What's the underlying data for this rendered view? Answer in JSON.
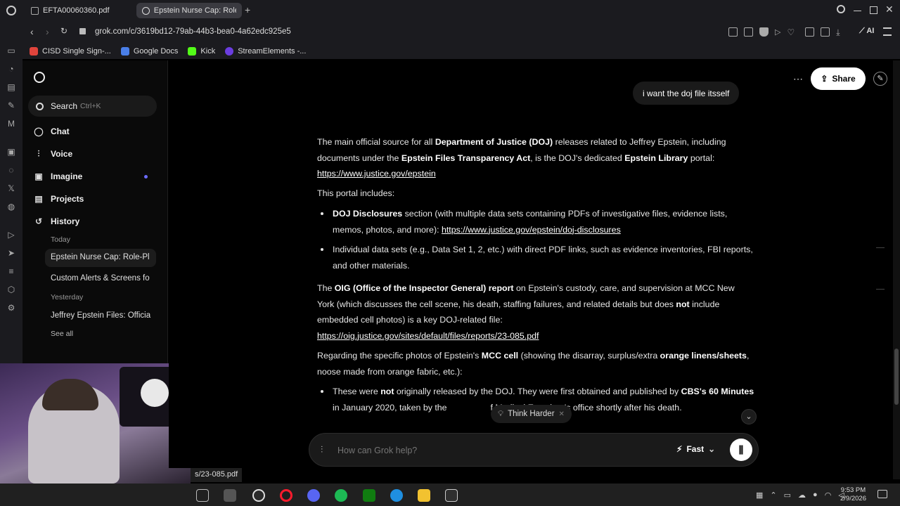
{
  "browser": {
    "tabs": [
      {
        "label": "EFTA00060360.pdf",
        "active": false
      },
      {
        "label": "Epstein Nurse Cap: Role-P",
        "active": true
      }
    ],
    "address": "grok.com/c/3619bd12-79ab-44b3-bea0-4a62edc925e5",
    "bookmarks": [
      {
        "label": "CISD Single Sign-...",
        "color": "#e0443c"
      },
      {
        "label": "Google Docs",
        "color": "#4a7fe8"
      },
      {
        "label": "Kick",
        "color": "#53fc18"
      },
      {
        "label": "StreamElements -...",
        "color": "#6b3de0"
      }
    ],
    "ai_label": "AI"
  },
  "sidebar": {
    "search_label": "Search",
    "search_shortcut": "Ctrl+K",
    "nav": [
      {
        "label": "Chat",
        "icon": "chat-icon"
      },
      {
        "label": "Voice",
        "icon": "voice-icon"
      },
      {
        "label": "Imagine",
        "icon": "imagine-icon"
      },
      {
        "label": "Projects",
        "icon": "projects-icon"
      },
      {
        "label": "History",
        "icon": "history-icon"
      }
    ],
    "history_today_label": "Today",
    "history_yesterday_label": "Yesterday",
    "history_items": [
      "Epstein Nurse Cap: Role-Pl",
      "Custom Alerts & Screens fo",
      "Jeffrey Epstein Files: Officia"
    ],
    "see_all": "See all"
  },
  "header": {
    "share_label": "Share"
  },
  "chat": {
    "user_message": "i want the doj file itsself",
    "p1": {
      "t1": "The main official source for all ",
      "b1": "Department of Justice (DOJ)",
      "t2": " releases related to Jeffrey Epstein, including documents under the ",
      "b2": "Epstein Files Transparency Act",
      "t3": ", is the DOJ's dedicated ",
      "b3": "Epstein Library",
      "t4": " portal:",
      "link": "https://www.justice.gov/epstein"
    },
    "p2": "This portal includes:",
    "bullet1": {
      "b": "DOJ Disclosures",
      "t": " section (with multiple data sets containing PDFs of investigative files, evidence lists, memos, photos, and more): ",
      "link": "https://www.justice.gov/epstein/doj-disclosures"
    },
    "bullet2": "Individual data sets (e.g., Data Set 1, 2, etc.) with direct PDF links, such as evidence inventories, FBI reports, and other materials.",
    "p3": {
      "t1": "The ",
      "b1": "OIG (Office of the Inspector General) report",
      "t2": " on Epstein's custody, care, and supervision at MCC New York (which discusses the cell scene, his death, staffing failures, and related details but does ",
      "b2": "not",
      "t3": " include embedded cell photos) is a key DOJ-related file:",
      "link": "https://oig.justice.gov/sites/default/files/reports/23-085.pdf"
    },
    "p4": {
      "t1": "Regarding the specific photos of Epstein's ",
      "b1": "MCC cell",
      "t2": " (showing the disarray, surplus/extra ",
      "b2": "orange linens/sheets",
      "t3": ", noose made from orange fabric, etc.):"
    },
    "bullet3": {
      "t1": "These were ",
      "b1": "not",
      "t2": " originally released by the DOJ. They were first obtained and published by ",
      "b2": "CBS's 60 Minutes",
      "t3": " in January 2020, taken by the ",
      "t4": "f Medical Examiner's office shortly after his death."
    },
    "think_harder": "Think Harder"
  },
  "composer": {
    "placeholder": "How can Grok help?",
    "mode_label": "Fast"
  },
  "status_url": "s/23-085.pdf",
  "clock": {
    "time": "9:53 PM",
    "date": "2/9/2026"
  }
}
